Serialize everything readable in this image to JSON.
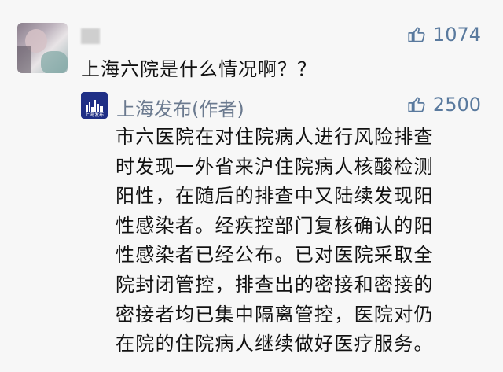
{
  "comment": {
    "text": "上海六院是什么情况啊？？",
    "like_icon": "thumbs-up-icon",
    "likes": "1074"
  },
  "reply": {
    "author": "上海发布(作者)",
    "avatar_caption": "上海发布",
    "like_icon": "thumbs-up-icon",
    "likes": "2500",
    "lines": [
      "市六医院在对住院病人进行风险排查",
      "时发现一外省来沪住院病人核酸检测",
      "阳性，在随后的排查中又陆续发现阳",
      "性感染者。经疾控部门复核确认的阳",
      "性感染者已经公布。已对医院采取全",
      "院封闭管控，排查出的密接和密接的",
      "密接者均已集中隔离管控，医院对仍",
      "在院的住院病人继续做好医疗服务。"
    ]
  },
  "colors": {
    "link_blue": "#5a7a9e",
    "name_gray": "#6b7a8f",
    "avatar_navy": "#1f2f86"
  }
}
